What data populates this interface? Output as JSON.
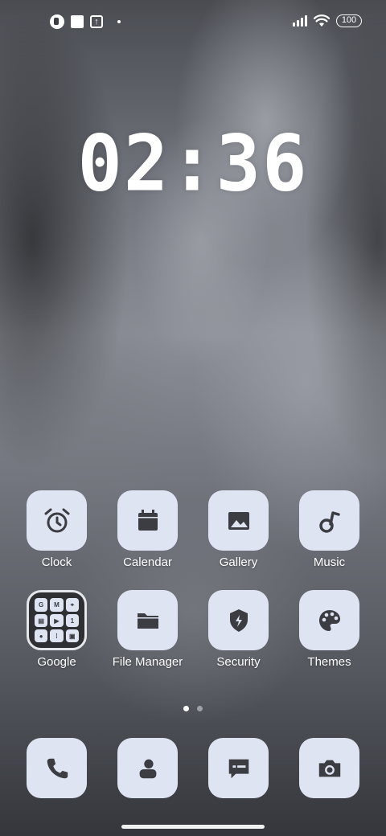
{
  "status_bar": {
    "battery_level": "100",
    "signal_bars": 4,
    "left_icons": [
      "app-notification-icon",
      "square-notification-icon",
      "upload-notification-icon",
      "dot-notification-icon"
    ],
    "right_icons": [
      "signal-icon",
      "wifi-icon",
      "battery-icon"
    ]
  },
  "clock": {
    "time": "02:36"
  },
  "apps": [
    {
      "label": "Clock",
      "icon": "alarm-clock-icon"
    },
    {
      "label": "Calendar",
      "icon": "calendar-icon"
    },
    {
      "label": "Gallery",
      "icon": "image-icon"
    },
    {
      "label": "Music",
      "icon": "music-note-icon"
    },
    {
      "label": "Google",
      "icon": "folder-grid-icon",
      "folder_items": [
        "G",
        "M",
        "⌖",
        "▤",
        "▶",
        "1",
        "●",
        "⁞",
        "▣"
      ]
    },
    {
      "label": "File Manager",
      "icon": "folder-icon"
    },
    {
      "label": "Security",
      "icon": "shield-bolt-icon"
    },
    {
      "label": "Themes",
      "icon": "palette-icon"
    }
  ],
  "page_indicator": {
    "pages": 2,
    "current": 1
  },
  "dock": [
    {
      "icon": "phone-icon"
    },
    {
      "icon": "contacts-icon"
    },
    {
      "icon": "message-icon"
    },
    {
      "icon": "camera-icon"
    }
  ],
  "colors": {
    "tile_bg": "#dfe4f2",
    "icon_fg": "#3b3d43",
    "text": "#ffffff"
  }
}
